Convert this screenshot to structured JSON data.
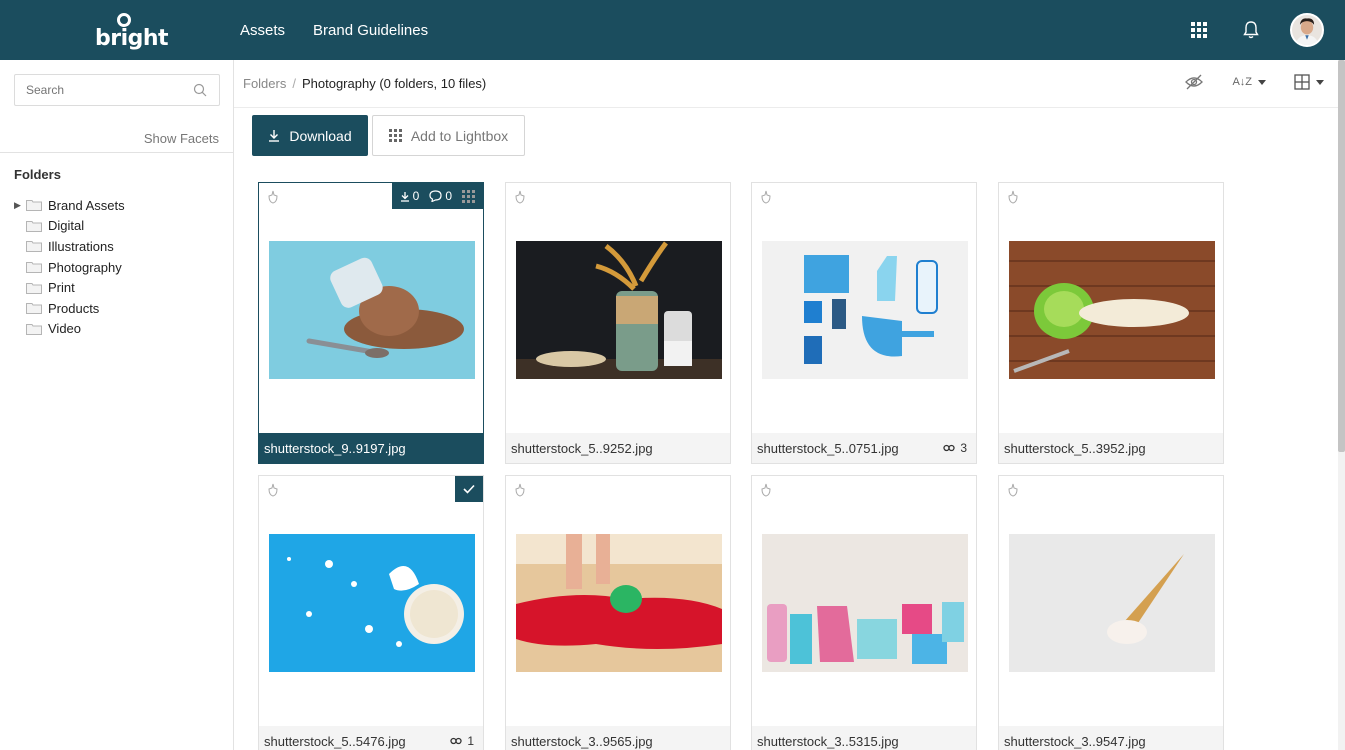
{
  "header": {
    "logo_text": "bright",
    "nav": [
      {
        "label": "Assets"
      },
      {
        "label": "Brand Guidelines"
      }
    ]
  },
  "sidebar": {
    "search_placeholder": "Search",
    "show_facets": "Show Facets",
    "folders_title": "Folders",
    "folders": [
      {
        "label": "Brand Assets",
        "expandable": true
      },
      {
        "label": "Digital"
      },
      {
        "label": "Illustrations"
      },
      {
        "label": "Photography"
      },
      {
        "label": "Print"
      },
      {
        "label": "Products"
      },
      {
        "label": "Video"
      }
    ]
  },
  "breadcrumb": {
    "root": "Folders",
    "separator": "/",
    "current": "Photography (0 folders, 10 files)"
  },
  "toolbar": {
    "download_label": "Download",
    "lightbox_label": "Add to Lightbox",
    "sort_icon_text": "A↓Z"
  },
  "selected_card_actions": {
    "downloads": "0",
    "comments": "0"
  },
  "assets": [
    {
      "filename": "shutterstock_9..9197.jpg",
      "usage": "",
      "selected": true
    },
    {
      "filename": "shutterstock_5..9252.jpg",
      "usage": ""
    },
    {
      "filename": "shutterstock_5..0751.jpg",
      "usage": "3"
    },
    {
      "filename": "shutterstock_5..3952.jpg",
      "usage": ""
    },
    {
      "filename": "shutterstock_5..5476.jpg",
      "usage": "1",
      "checked": true
    },
    {
      "filename": "shutterstock_3..9565.jpg",
      "usage": ""
    },
    {
      "filename": "shutterstock_3..5315.jpg",
      "usage": ""
    },
    {
      "filename": "shutterstock_3..9547.jpg",
      "usage": ""
    }
  ],
  "colors": {
    "brand": "#1b4d5e",
    "footer_bg": "#f4f4f4"
  }
}
